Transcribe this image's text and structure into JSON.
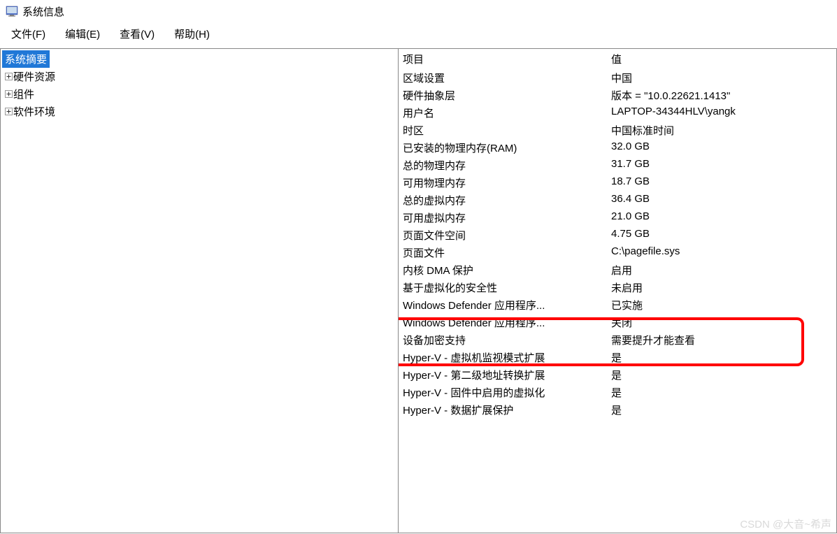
{
  "window": {
    "title": "系统信息"
  },
  "menu": {
    "file": "文件(F)",
    "edit": "编辑(E)",
    "view": "查看(V)",
    "help": "帮助(H)"
  },
  "tree": {
    "root": "系统摘要",
    "items": [
      "硬件资源",
      "组件",
      "软件环境"
    ]
  },
  "details": {
    "header_item": "项目",
    "header_value": "值",
    "rows": [
      {
        "item": "区域设置",
        "value": "中国"
      },
      {
        "item": "硬件抽象层",
        "value": "版本 = \"10.0.22621.1413\""
      },
      {
        "item": "用户名",
        "value": "LAPTOP-34344HLV\\yangk"
      },
      {
        "item": "时区",
        "value": "中国标准时间"
      },
      {
        "item": "已安装的物理内存(RAM)",
        "value": "32.0 GB"
      },
      {
        "item": "总的物理内存",
        "value": "31.7 GB"
      },
      {
        "item": "可用物理内存",
        "value": "18.7 GB"
      },
      {
        "item": "总的虚拟内存",
        "value": "36.4 GB"
      },
      {
        "item": "可用虚拟内存",
        "value": "21.0 GB"
      },
      {
        "item": "页面文件空间",
        "value": "4.75 GB"
      },
      {
        "item": "页面文件",
        "value": "C:\\pagefile.sys"
      },
      {
        "item": "内核 DMA 保护",
        "value": "启用"
      },
      {
        "item": "基于虚拟化的安全性",
        "value": "未启用"
      },
      {
        "item": "Windows Defender 应用程序...",
        "value": "已实施"
      },
      {
        "item": "Windows Defender 应用程序...",
        "value": "关闭"
      },
      {
        "item": "设备加密支持",
        "value": "需要提升才能查看"
      },
      {
        "item": "Hyper-V - 虚拟机监视模式扩展",
        "value": "是"
      },
      {
        "item": "Hyper-V - 第二级地址转换扩展",
        "value": "是"
      },
      {
        "item": "Hyper-V - 固件中启用的虚拟化",
        "value": "是"
      },
      {
        "item": "Hyper-V - 数据扩展保护",
        "value": "是"
      }
    ]
  },
  "watermark": "CSDN @大音~希声"
}
